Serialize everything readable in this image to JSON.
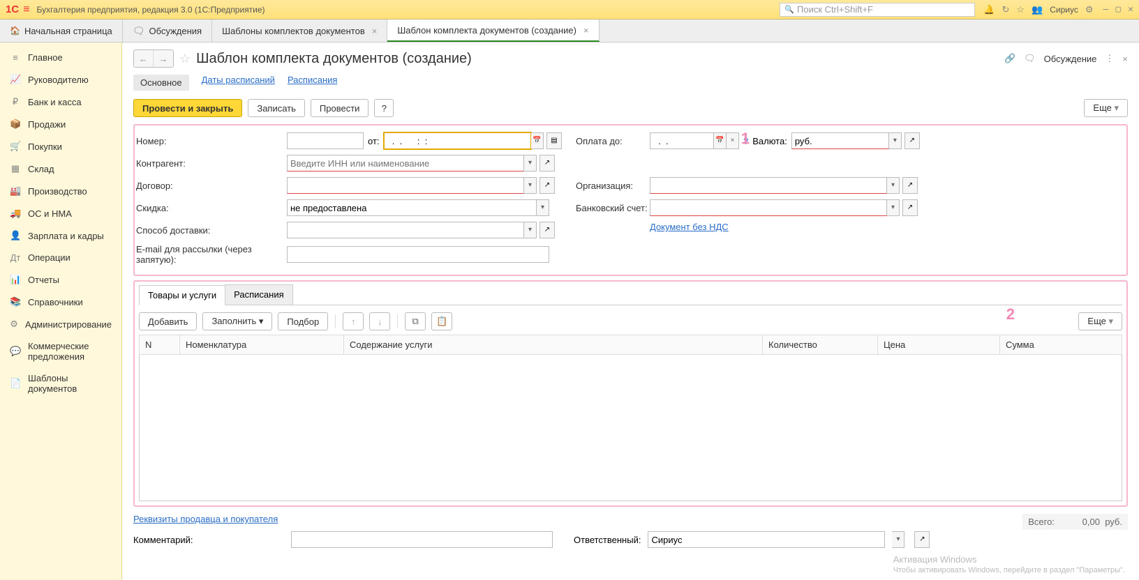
{
  "titlebar": {
    "app_title": "Бухгалтерия предприятия, редакция 3.0  (1С:Предприятие)",
    "search_placeholder": "Поиск Ctrl+Shift+F",
    "user": "Сириус"
  },
  "tabs": {
    "start": "Начальная страница",
    "discuss": "Обсуждения",
    "tpl_list": "Шаблоны комплектов документов",
    "tpl_create": "Шаблон комплекта документов (создание)"
  },
  "sidebar": [
    "Главное",
    "Руководителю",
    "Банк и касса",
    "Продажи",
    "Покупки",
    "Склад",
    "Производство",
    "ОС и НМА",
    "Зарплата и кадры",
    "Операции",
    "Отчеты",
    "Справочники",
    "Администрирование",
    "Коммерческие предложения",
    "Шаблоны документов"
  ],
  "page": {
    "title": "Шаблон комплекта документов (создание)",
    "subtabs": {
      "main": "Основное",
      "dates": "Даты расписаний",
      "sched": "Расписания"
    },
    "actions": {
      "post_close": "Провести и закрыть",
      "write": "Записать",
      "post": "Провести",
      "help": "?",
      "more": "Еще"
    },
    "discuss_btn": "Обсуждение"
  },
  "form": {
    "labels": {
      "number": "Номер:",
      "from": "от:",
      "counterparty": "Контрагент:",
      "contract": "Договор:",
      "discount": "Скидка:",
      "delivery": "Способ доставки:",
      "email": "E-mail для рассылки (через запятую):",
      "pay_until": "Оплата до:",
      "currency": "Валюта:",
      "org": "Организация:",
      "bank_acc": "Банковский счет:"
    },
    "values": {
      "number": "",
      "date": "  .  .      :  :",
      "counterparty_placeholder": "Введите ИНН или наименование",
      "contract": "",
      "discount": "не предоставлена",
      "delivery": "",
      "email": "",
      "pay_until": "  .  .",
      "currency": "руб.",
      "org": "",
      "bank_acc": "",
      "no_vat": "Документ без НДС"
    }
  },
  "tabletabs": {
    "goods": "Товары и услуги",
    "sched": "Расписания"
  },
  "table_actions": {
    "add": "Добавить",
    "fill": "Заполнить",
    "select": "Подбор",
    "more": "Еще"
  },
  "table": {
    "cols": [
      "N",
      "Номенклатура",
      "Содержание услуги",
      "Количество",
      "Цена",
      "Сумма"
    ]
  },
  "footer": {
    "requisites_link": "Реквизиты продавца и покупателя",
    "total_label": "Всего:",
    "total_value": "0,00",
    "total_cur": "руб.",
    "comment_label": "Комментарий:",
    "comment": "",
    "responsible_label": "Ответственный:",
    "responsible": "Сириус"
  },
  "watermark": {
    "title": "Активация Windows",
    "sub": "Чтобы активировать Windows, перейдите в раздел \"Параметры\"."
  },
  "annotations": {
    "b1": "1",
    "b2": "2"
  }
}
